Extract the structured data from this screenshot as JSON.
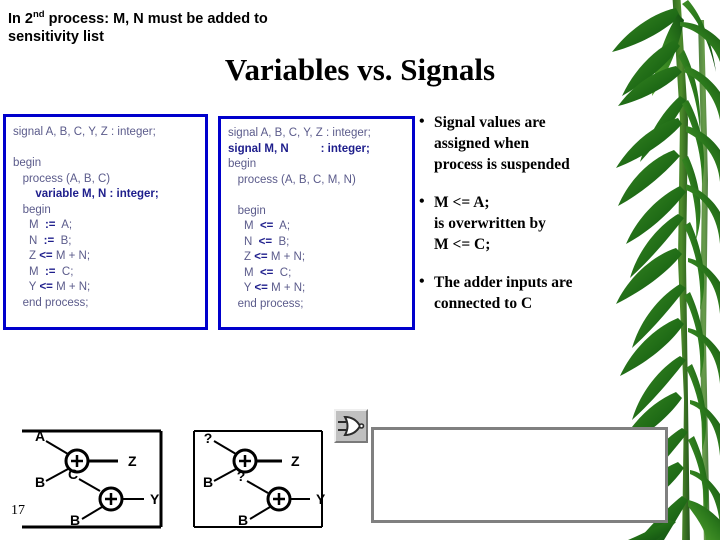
{
  "slide": {
    "title": "Variables vs. Signals",
    "number": "17",
    "background_color": "#FFFFFF",
    "title_color": "#000000"
  },
  "code_boxes": [
    {
      "name": "variables-version",
      "border_color": "#0000CC",
      "text_color": "#5B5B8B",
      "bold_color": "#1E1E8C",
      "lines": [
        {
          "text": "signal A, B, C, Y, Z : integer;",
          "bold": false
        },
        {
          "text": "",
          "bold": false
        },
        {
          "text": "begin",
          "bold": false
        },
        {
          "text": "   process (A, B, C)",
          "bold": false
        },
        {
          "text": "       variable M, N : integer;",
          "bold": true
        },
        {
          "text": "   begin",
          "bold": false
        },
        {
          "text": "     M  :=  A;",
          "bold": false
        },
        {
          "text": "     N  :=  B;",
          "bold": false
        },
        {
          "text": "     Z <= M + N;",
          "bold": false
        },
        {
          "text": "     M  :=  C;",
          "bold": false
        },
        {
          "text": "     Y <= M + N;",
          "bold": false
        },
        {
          "text": "   end process;",
          "bold": false
        }
      ]
    },
    {
      "name": "signals-version",
      "border_color": "#0000CC",
      "text_color": "#5B5B8B",
      "bold_color": "#1E1E8C",
      "lines": [
        {
          "text": "signal A, B, C, Y, Z : integer;",
          "bold": false
        },
        {
          "text": "signal M, N          : integer;",
          "bold": true
        },
        {
          "text": "begin",
          "bold": false
        },
        {
          "text": "   process (A, B, C, M, N)",
          "bold": false
        },
        {
          "text": "",
          "bold": false
        },
        {
          "text": "   begin",
          "bold": false
        },
        {
          "text": "     M  <=  A;",
          "bold": false
        },
        {
          "text": "     N  <=  B;",
          "bold": false
        },
        {
          "text": "     Z <= M + N;",
          "bold": false
        },
        {
          "text": "     M  <=  C;",
          "bold": false
        },
        {
          "text": "     Y <= M + N;",
          "bold": false
        },
        {
          "text": "   end process;",
          "bold": false
        }
      ]
    }
  ],
  "bullets": [
    {
      "marker": "•",
      "lines": [
        "Signal values are",
        "assigned when",
        "process is suspended"
      ]
    },
    {
      "marker": "•",
      "lines": [
        "M <= A;",
        "is overwritten by",
        "M <= C;"
      ]
    },
    {
      "marker": "•",
      "lines": [
        "The adder inputs are",
        "connected to C"
      ]
    }
  ],
  "diagrams": [
    {
      "name": "variables-circuit",
      "adders": [
        {
          "symbol": "+",
          "inputs": [
            "A",
            "B"
          ],
          "output": "Z"
        },
        {
          "symbol": "+",
          "inputs": [
            "C",
            "B"
          ],
          "output": "Y"
        }
      ]
    },
    {
      "name": "signals-circuit",
      "adders": [
        {
          "symbol": "+",
          "inputs": [
            "?",
            "B"
          ],
          "output": "Z"
        },
        {
          "symbol": "+",
          "inputs": [
            "?",
            "B"
          ],
          "output": "Y"
        }
      ]
    }
  ],
  "note": {
    "text_before_sup": "In 2",
    "sup": "nd",
    "text_after_sup": " process: M, N must be added to sensitivity list",
    "border_color": "#808080"
  },
  "gate_icon": {
    "name": "or-gate-icon",
    "button_face_color": "#C0C0C0"
  }
}
